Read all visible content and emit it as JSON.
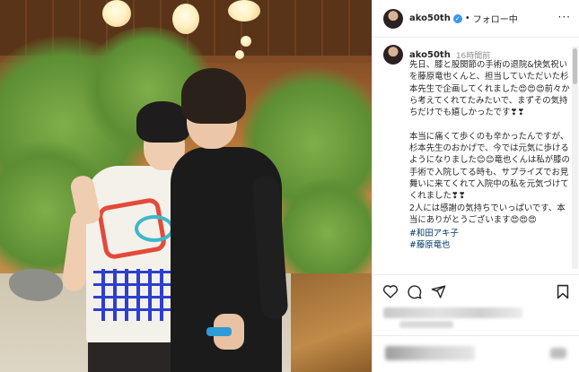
{
  "post": {
    "header": {
      "username": "ako50th",
      "verified_mark": "✓",
      "separator": "•",
      "follow_status": "フォロー中",
      "more_icon": "more-horizontal-icon",
      "more_glyph": "···"
    },
    "caption": {
      "username": "ako50th",
      "time_ago": "16時間前",
      "text": "先日、膝と股関節の手術の退院&快気祝いを藤原竜也くんと、担当していただいた杉本先生で企画してくれました😍😍😍前々から考えてくれてたみたいで、まずその気持ちだけでも嬉しかったです❣❣\n\n本当に痛くて歩くのも辛かったんですが、杉本先生のおかげで、今では元気に歩けるようになりました😊😊竜也くんは私が膝の手術で入院してる時も、サプライズでお見舞いに来てくれて入院中の私を元気づけてくれました❣❣\n2人には感謝の気持ちでいっぱいです、本当にありがとうございます😍😍😍",
      "hashtags": [
        "#和田アキ子",
        "#藤原竜也"
      ]
    },
    "actions": [
      {
        "icon": "heart-icon",
        "label": "いいね"
      },
      {
        "icon": "comment-icon",
        "label": "コメント"
      },
      {
        "icon": "share-icon",
        "label": "シェア"
      },
      {
        "icon": "bookmark-icon",
        "label": "保存"
      }
    ],
    "photo": {
      "description_icon": "photo"
    },
    "colors": {
      "link": "#00376b",
      "verified": "#3897f0",
      "muted": "#8e8e8e",
      "text": "#262626"
    }
  }
}
